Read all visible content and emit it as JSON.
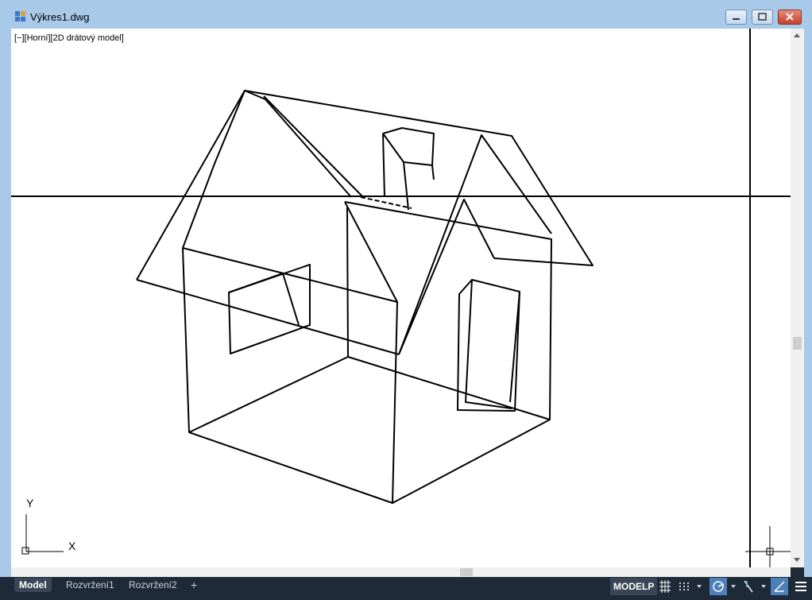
{
  "window": {
    "title": "Výkres1.dwg",
    "title_icon": "autocad-drawing-icon",
    "minimize_icon": "minimize-icon",
    "restore_icon": "restore-icon",
    "close_icon": "close-icon"
  },
  "viewport": {
    "label": "[−][Horní][2D drátový model]",
    "ucs_x_label": "X",
    "ucs_y_label": "Y"
  },
  "tabs": [
    {
      "label": "Model",
      "active": true
    },
    {
      "label": "Rozvržení1",
      "active": false
    },
    {
      "label": "Rozvržení2",
      "active": false
    },
    {
      "label": "+",
      "active": false
    }
  ],
  "status": {
    "space_label": "MODELP",
    "buttons": [
      "grid-icon",
      "snap-icon",
      "polar-tracking-icon",
      "osnap-icon",
      "isodraft-icon",
      "customize-menu-icon"
    ]
  },
  "colors": {
    "frame": "#a9c9e8",
    "statusbar": "#1f2a38",
    "active_toggle": "#4d7fb8"
  }
}
